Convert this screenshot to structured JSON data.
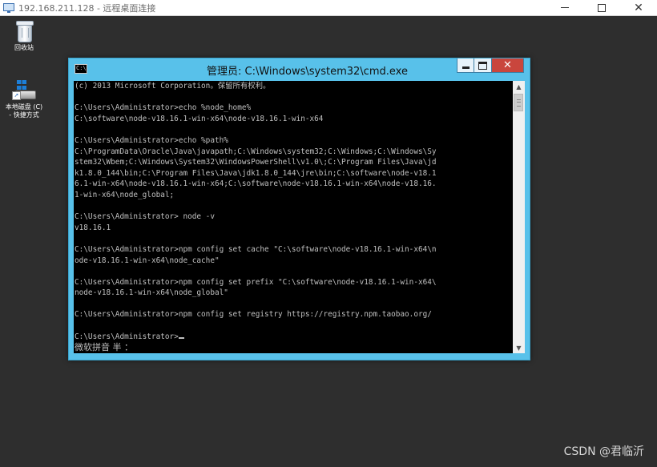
{
  "rdp": {
    "title": "192.168.211.128 - 远程桌面连接",
    "minimize": "",
    "maximize": "",
    "close": "✕"
  },
  "desktop": {
    "icons": [
      {
        "label": "回收站",
        "icon": "recycle-bin-icon"
      },
      {
        "label": "本地磁盘 (C)\n- 快捷方式",
        "icon": "local-disk-shortcut-icon"
      }
    ]
  },
  "cmd": {
    "title": "管理员: C:\\Windows\\system32\\cmd.exe",
    "icon_text": "C:\\",
    "close": "✕",
    "lines": [
      "(c) 2013 Microsoft Corporation。保留所有权利。",
      "",
      "C:\\Users\\Administrator>echo %node_home%",
      "C:\\software\\node-v18.16.1-win-x64\\node-v18.16.1-win-x64",
      "",
      "C:\\Users\\Administrator>echo %path%",
      "C:\\ProgramData\\Oracle\\Java\\javapath;C:\\Windows\\system32;C:\\Windows;C:\\Windows\\Sy",
      "stem32\\Wbem;C:\\Windows\\System32\\WindowsPowerShell\\v1.0\\;C:\\Program Files\\Java\\jd",
      "k1.8.0_144\\bin;C:\\Program Files\\Java\\jdk1.8.0_144\\jre\\bin;C:\\software\\node-v18.1",
      "6.1-win-x64\\node-v18.16.1-win-x64;C:\\software\\node-v18.16.1-win-x64\\node-v18.16.",
      "1-win-x64\\node_global;",
      "",
      "C:\\Users\\Administrator> node -v",
      "v18.16.1",
      "",
      "C:\\Users\\Administrator>npm config set cache \"C:\\software\\node-v18.16.1-win-x64\\n",
      "ode-v18.16.1-win-x64\\node_cache\"",
      "",
      "C:\\Users\\Administrator>npm config set prefix \"C:\\software\\node-v18.16.1-win-x64\\",
      "node-v18.16.1-win-x64\\node_global\"",
      "",
      "C:\\Users\\Administrator>npm config set registry https://registry.npm.taobao.org/",
      ""
    ],
    "prompt": "C:\\Users\\Administrator>",
    "ime": "微软拼音 半 ："
  },
  "scrollbar": {
    "up": "▲",
    "down": "▼"
  },
  "watermark": "CSDN @君临沂"
}
